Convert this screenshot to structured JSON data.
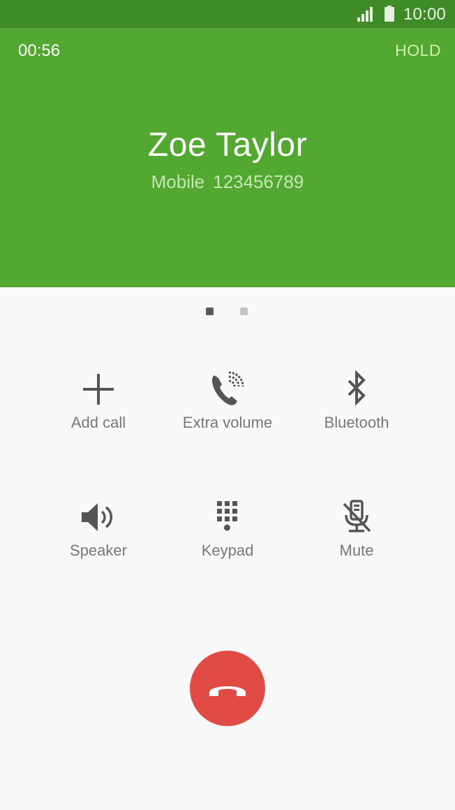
{
  "status_bar": {
    "time": "10:00",
    "signal_icon": "signal-icon",
    "battery_icon": "battery-icon"
  },
  "call": {
    "timer": "00:56",
    "hold_label": "HOLD",
    "contact_name": "Zoe Taylor",
    "number_type": "Mobile",
    "number": "123456789"
  },
  "pager": {
    "total_pages": 2,
    "current_page": 1
  },
  "actions": [
    {
      "label": "Add call",
      "icon": "plus-icon"
    },
    {
      "label": "Extra volume",
      "icon": "extra-volume-icon"
    },
    {
      "label": "Bluetooth",
      "icon": "bluetooth-icon"
    },
    {
      "label": "Speaker",
      "icon": "speaker-icon"
    },
    {
      "label": "Keypad",
      "icon": "keypad-icon"
    },
    {
      "label": "Mute",
      "icon": "mute-icon"
    }
  ],
  "end_call": {
    "icon": "end-call-icon"
  },
  "colors": {
    "status_bar": "#3f8b28",
    "header": "#52a830",
    "hold_text": "#d4f0a8",
    "end_call": "#e04c45",
    "icon": "#555555",
    "label": "#777777",
    "background": "#f8f8f8"
  }
}
